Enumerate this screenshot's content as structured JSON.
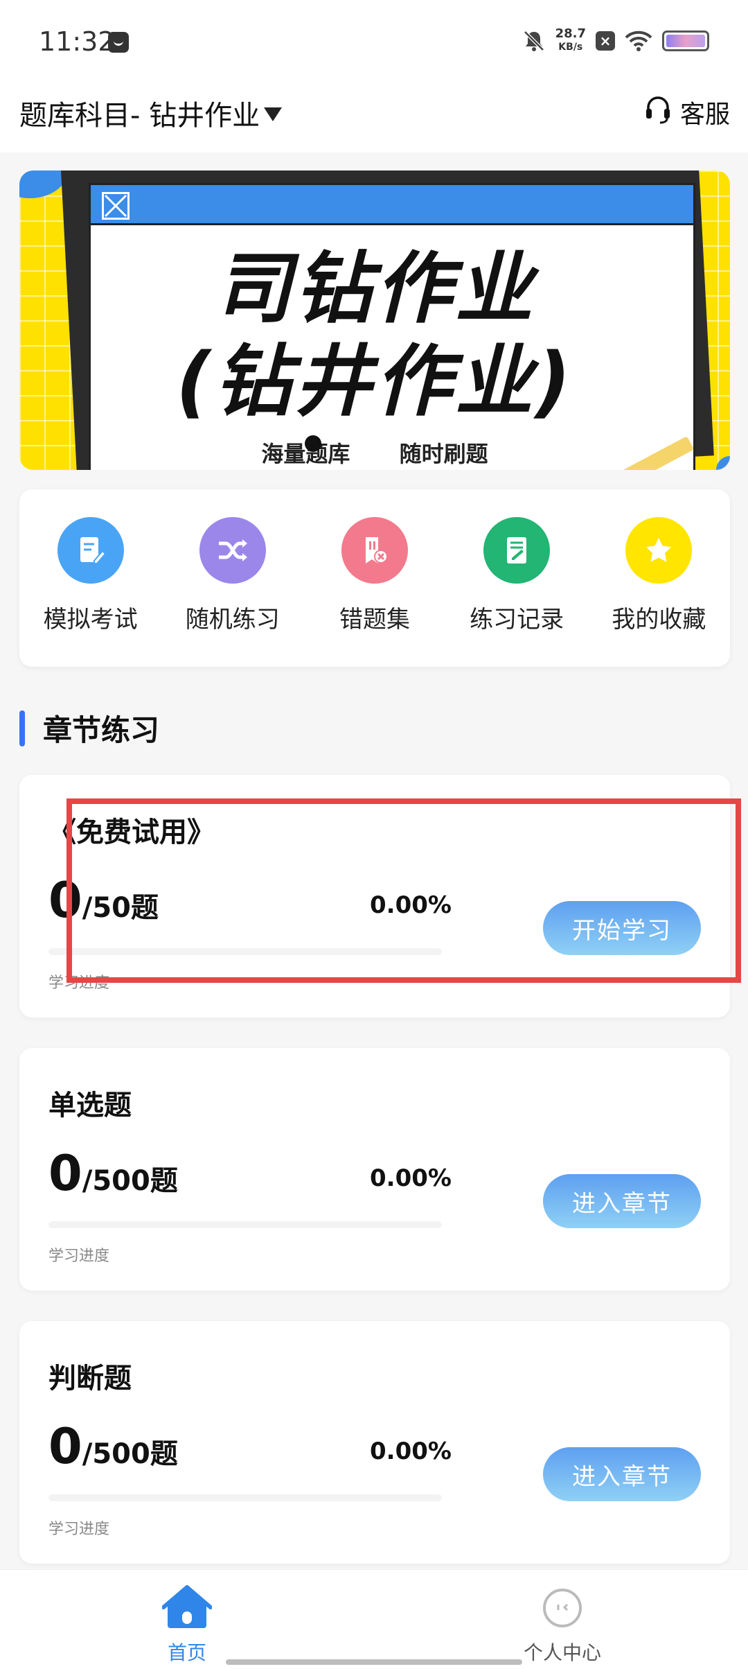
{
  "status_bar": {
    "time": "11:32",
    "net_speed_value": "28.7",
    "net_speed_unit": "KB/s",
    "icons": [
      "message-icon",
      "bell-off-icon",
      "close-badge-icon",
      "wifi-icon",
      "battery-icon"
    ]
  },
  "header": {
    "subject_label": "题库科目- 钻井作业",
    "service_label": "客服"
  },
  "banner": {
    "title_line1": "司钻作业",
    "title_line2": "(钻井作业)",
    "subtitle": "海量题库 随时刷题",
    "colors": {
      "background": "#ffe100",
      "accent": "#3b8de8"
    }
  },
  "quick_entries": [
    {
      "label": "模拟考试",
      "icon": "exam-icon",
      "color": "#4aa4f5"
    },
    {
      "label": "随机练习",
      "icon": "shuffle-icon",
      "color": "#9b87ea"
    },
    {
      "label": "错题集",
      "icon": "wrong-questions-icon",
      "color": "#f27a8c"
    },
    {
      "label": "练习记录",
      "icon": "record-icon",
      "color": "#22b573"
    },
    {
      "label": "我的收藏",
      "icon": "star-icon",
      "color": "#ffe500"
    }
  ],
  "section": {
    "title": "章节练习"
  },
  "chapters": [
    {
      "title": "《免费试用》",
      "done": "0",
      "total_text": "/50题",
      "percent": "0.00%",
      "progress": 0.0,
      "progress_label": "学习进度",
      "button": "开始学习"
    },
    {
      "title": "单选题",
      "done": "0",
      "total_text": "/500题",
      "percent": "0.00%",
      "progress": 0.0,
      "progress_label": "学习进度",
      "button": "进入章节"
    },
    {
      "title": "判断题",
      "done": "0",
      "total_text": "/500题",
      "percent": "0.00%",
      "progress": 0.0,
      "progress_label": "学习进度",
      "button": "进入章节"
    }
  ],
  "bottom_nav": {
    "home_label": "首页",
    "profile_label": "个人中心",
    "active": "home",
    "active_color": "#2f86e8",
    "inactive_color": "#555555"
  }
}
